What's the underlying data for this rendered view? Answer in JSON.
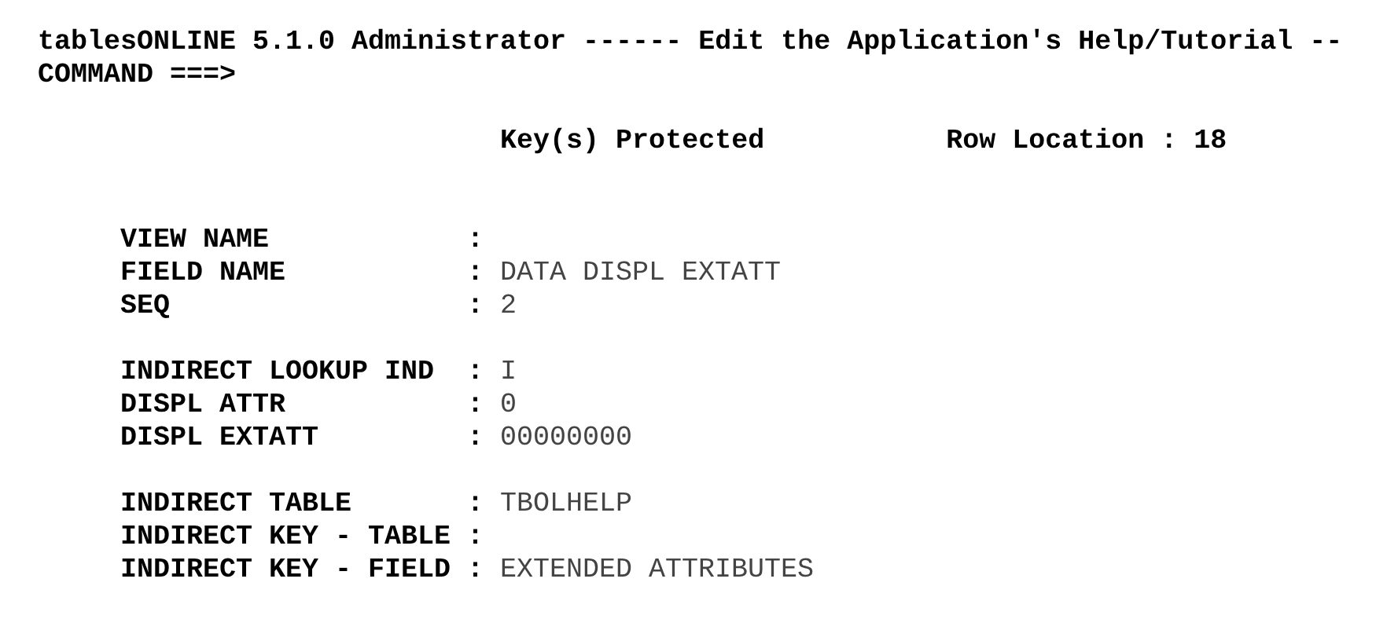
{
  "title": "tablesONLINE 5.1.0 Administrator ------ Edit the Application's Help/Tutorial --",
  "command_prompt": "COMMAND ===>",
  "key_status": "Key(s) Protected",
  "row_location": "Row Location : 18",
  "field_groups": [
    [
      {
        "label": "VIEW NAME",
        "separator": ":"
      },
      {
        "label": "FIELD NAME",
        "separator": ":",
        "value": "DATA DISPL EXTATT"
      },
      {
        "label": "SEQ",
        "separator": ":",
        "value": "2"
      }
    ],
    [
      {
        "label": "INDIRECT LOOKUP IND",
        "separator": ":",
        "value": "I"
      },
      {
        "label": "DISPL ATTR",
        "separator": ":",
        "value": "0"
      },
      {
        "label": "DISPL EXTATT",
        "separator": ":",
        "value": "00000000"
      }
    ],
    [
      {
        "label": "INDIRECT TABLE",
        "separator": ":",
        "value": "TBOLHELP"
      },
      {
        "label": "INDIRECT KEY - TABLE",
        "separator": ":"
      },
      {
        "label": "INDIRECT KEY - FIELD",
        "separator": ":",
        "value": "EXTENDED ATTRIBUTES"
      }
    ]
  ]
}
